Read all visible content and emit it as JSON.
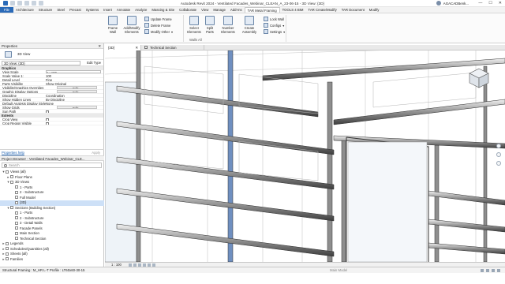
{
  "titlebar": {
    "title": "Autodesk Revit 2024 - Ventilated Facades_Webinar_CLEAN_A_23-06-15 - 3D View: {3D}",
    "user": "AGACADBenk..."
  },
  "ribbon_tabs": [
    "File",
    "Architecture",
    "Structure",
    "Steel",
    "Precast",
    "Systems",
    "Insert",
    "Annotate",
    "Analyze",
    "Massing & Site",
    "Collaborate",
    "View",
    "Manage",
    "Add-Ins",
    "TAR Metal Framing",
    "TOOLS 4 BIM",
    "TAR Create/Modify",
    "TAR Document",
    "Modify"
  ],
  "ribbon": {
    "frame_wall": "Frame\nWall",
    "add_modify_elements": "Add/Modify\nElements",
    "update_frame": "Update Frame",
    "delete_frame": "Delete Frame",
    "modify_other": "Modify Other",
    "select_elements": "Select\nElements",
    "split_parts": "Split\nParts",
    "number_elements": "Number\nElements",
    "create_assembly": "Create\nAssembly",
    "lock_wall": "Lock Wall",
    "configs": "Configs",
    "settings": "Settings",
    "panel_walls_all": "Walls All"
  },
  "properties": {
    "header": "Properties",
    "type": "3D View",
    "filter": "3D View: {3D}",
    "edit_type": "Edit Type",
    "sections": [
      {
        "name": "Graphics",
        "rows": [
          {
            "k": "View Scale",
            "v": "1 : 100",
            "style": "box"
          },
          {
            "k": "Scale Value 1:",
            "v": "100",
            "style": "plain"
          },
          {
            "k": "Detail Level",
            "v": "Fine",
            "style": "plain"
          },
          {
            "k": "Parts Visibility",
            "v": "Show Original",
            "style": "plain"
          },
          {
            "k": "Visibility/Graphics Overrides",
            "v": "Edit...",
            "style": "btn"
          },
          {
            "k": "Graphic Display Options",
            "v": "Edit...",
            "style": "btn"
          },
          {
            "k": "Discipline",
            "v": "Coordination",
            "style": "plain"
          },
          {
            "k": "Show Hidden Lines",
            "v": "By Discipline",
            "style": "plain"
          },
          {
            "k": "Default Analysis Display Style",
            "v": "None",
            "style": "plain"
          },
          {
            "k": "Show Grids",
            "v": "Edit...",
            "style": "btn"
          },
          {
            "k": "Sun Path",
            "v": "",
            "style": "check"
          }
        ]
      },
      {
        "name": "Extents",
        "rows": [
          {
            "k": "Crop View",
            "v": "",
            "style": "check"
          },
          {
            "k": "Crop Region Visible",
            "v": "",
            "style": "check"
          }
        ]
      }
    ],
    "help_link": "Properties help",
    "apply": "Apply"
  },
  "project_browser": {
    "header": "Project Browser - Ventilated Facades_Webinar_CLE...",
    "search_placeholder": "Search",
    "tree": [
      {
        "d": 0,
        "t": "▾",
        "label": "Views (all)"
      },
      {
        "d": 1,
        "t": "▸",
        "label": "Floor Plans"
      },
      {
        "d": 1,
        "t": "▾",
        "label": "3D Views"
      },
      {
        "d": 2,
        "t": "",
        "label": "1 - Parts"
      },
      {
        "d": 2,
        "t": "",
        "label": "2 - Substructure"
      },
      {
        "d": 2,
        "t": "",
        "label": "Full Model"
      },
      {
        "d": 2,
        "t": "",
        "label": "{3D}",
        "sel": true
      },
      {
        "d": 1,
        "t": "▾",
        "label": "Sections (Building Section)"
      },
      {
        "d": 2,
        "t": "",
        "label": "1 - Parts"
      },
      {
        "d": 2,
        "t": "",
        "label": "2 - Substructure"
      },
      {
        "d": 2,
        "t": "",
        "label": "3 - Detail Walls"
      },
      {
        "d": 2,
        "t": "",
        "label": "Facade Panels"
      },
      {
        "d": 2,
        "t": "",
        "label": "Main Section"
      },
      {
        "d": 2,
        "t": "",
        "label": "Technical Section"
      },
      {
        "d": 0,
        "t": "▸",
        "label": "Legends"
      },
      {
        "d": 0,
        "t": "▸",
        "label": "Schedules/Quantities (all)"
      },
      {
        "d": 0,
        "t": "▸",
        "label": "Sheets (all)"
      },
      {
        "d": 0,
        "t": "▸",
        "label": "Families"
      }
    ]
  },
  "view_tabs": [
    "{3D}",
    "Technical Section"
  ],
  "view_control": {
    "scale": "1 : 100"
  },
  "status": {
    "message": "Structural Framing : M_HR L-T Profile : LT60x60-30-15",
    "main_model": "Main Model"
  },
  "win": {
    "minimize": "—",
    "maximize": "☐",
    "close": "✕"
  }
}
